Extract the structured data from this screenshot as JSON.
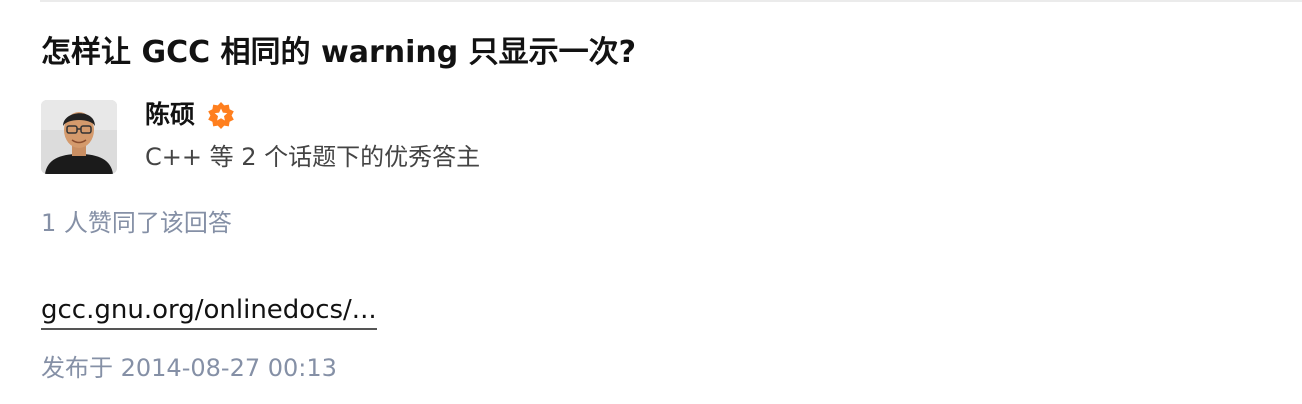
{
  "question": {
    "title": "怎样让 GCC 相同的 warning 只显示一次?"
  },
  "author": {
    "name": "陈硕",
    "headline": "C++ 等 2 个话题下的优秀答主",
    "avatar_icon": "user-photo-avatar",
    "badge_icon": "excellent-answerer-badge",
    "badge_color": "#ff7f1e"
  },
  "answer": {
    "vote_text": "1 人赞同了该回答",
    "link_text": "gcc.gnu.org/onlinedocs/...",
    "publish_time": "发布于 2014-08-27 00:13"
  },
  "colors": {
    "title": "#121212",
    "meta_gray": "#8590a6",
    "headline_gray": "#444444"
  }
}
